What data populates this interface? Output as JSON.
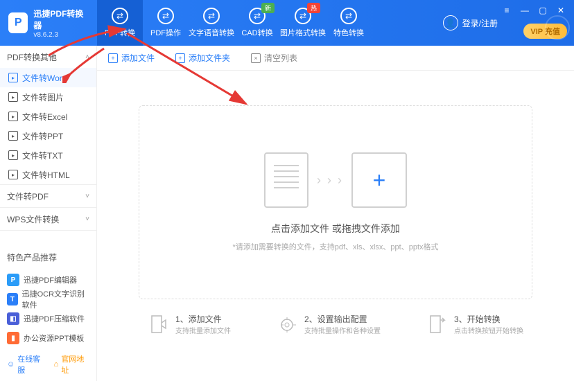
{
  "app": {
    "title": "迅捷PDF转换器",
    "version": "v8.6.2.3"
  },
  "nav": [
    {
      "label": "PDF转换",
      "active": true
    },
    {
      "label": "PDF操作"
    },
    {
      "label": "文字语音转换"
    },
    {
      "label": "CAD转换",
      "badge": "新",
      "badgeColor": "green"
    },
    {
      "label": "图片格式转换",
      "badge": "热",
      "badgeColor": "red"
    },
    {
      "label": "特色转换"
    }
  ],
  "login": "登录/注册",
  "vip": "充值",
  "sidebar": {
    "groups": [
      {
        "title": "PDF转换其他",
        "chev": "˄",
        "items": [
          {
            "label": "文件转Word",
            "active": true
          },
          {
            "label": "文件转图片"
          },
          {
            "label": "文件转Excel"
          },
          {
            "label": "文件转PPT"
          },
          {
            "label": "文件转TXT"
          },
          {
            "label": "文件转HTML"
          }
        ]
      },
      {
        "title": "文件转PDF",
        "chev": "˅",
        "items": []
      },
      {
        "title": "WPS文件转换",
        "chev": "˅",
        "items": []
      }
    ],
    "promoTitle": "特色产品推荐",
    "promos": [
      {
        "label": "迅捷PDF编辑器",
        "color": "#2b9cf8",
        "icon": "P"
      },
      {
        "label": "迅捷OCR文字识别软件",
        "color": "#2b7ff8",
        "icon": "T"
      },
      {
        "label": "迅捷PDF压缩软件",
        "color": "#4a5fd8",
        "icon": "◧"
      },
      {
        "label": "办公资源PPT模板",
        "color": "#ff6b35",
        "icon": "▮"
      }
    ],
    "footer": [
      {
        "label": "在线客服",
        "icon": "☺"
      },
      {
        "label": "官网地址",
        "icon": "⌂"
      }
    ]
  },
  "toolbar": [
    {
      "label": "添加文件",
      "icon": "+"
    },
    {
      "label": "添加文件夹",
      "icon": "+"
    },
    {
      "label": "清空列表",
      "icon": "×",
      "gray": true
    }
  ],
  "drop": {
    "title": "点击添加文件 或拖拽文件添加",
    "sub": "*请添加需要转换的文件，支持pdf、xls、xlsx、ppt、pptx格式"
  },
  "steps": [
    {
      "num": "1、",
      "title": "添加文件",
      "sub": "支持批量添加文件"
    },
    {
      "num": "2、",
      "title": "设置输出配置",
      "sub": "支持批量操作和各种设置"
    },
    {
      "num": "3、",
      "title": "开始转换",
      "sub": "点击转换按钮开始转换"
    }
  ]
}
